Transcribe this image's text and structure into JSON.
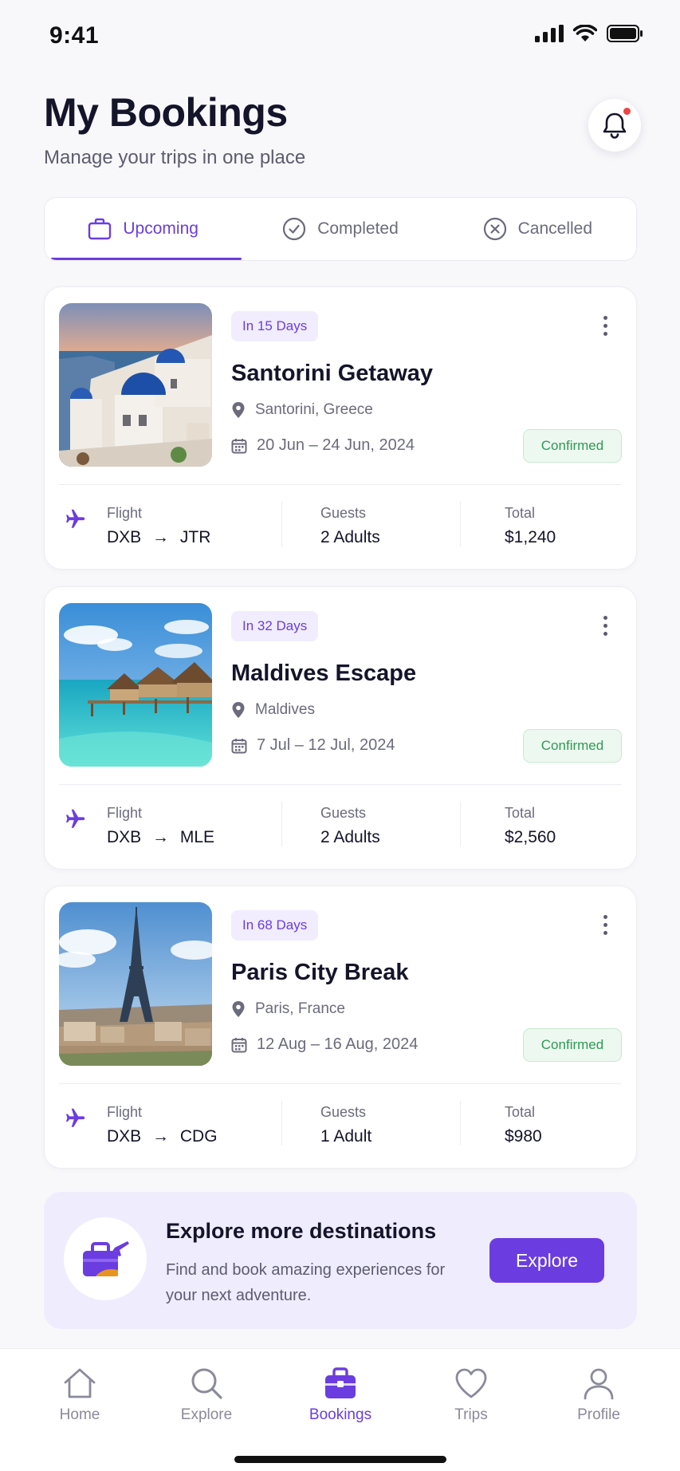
{
  "status_bar": {
    "time": "9:41"
  },
  "header": {
    "title": "My Bookings",
    "subtitle": "Manage your trips in one place",
    "notification_icon": "bell-icon"
  },
  "tabs": [
    {
      "label": "Upcoming",
      "icon": "briefcase-icon",
      "active": true
    },
    {
      "label": "Completed",
      "icon": "check-circle-icon",
      "active": false
    },
    {
      "label": "Cancelled",
      "icon": "x-circle-icon",
      "active": false
    }
  ],
  "bookings": [
    {
      "badge": "In 15 Days",
      "title": "Santorini Getaway",
      "location": "Santorini, Greece",
      "dates": "20 Jun – 24 Jun, 2024",
      "status": "Confirmed",
      "flight_label": "Flight",
      "flight_from": "DXB",
      "flight_to": "JTR",
      "guests_label": "Guests",
      "guests": "2 Adults",
      "total_label": "Total",
      "total": "$1,240"
    },
    {
      "badge": "In 32 Days",
      "title": "Maldives Escape",
      "location": "Maldives",
      "dates": "7 Jul – 12 Jul, 2024",
      "status": "Confirmed",
      "flight_label": "Flight",
      "flight_from": "DXB",
      "flight_to": "MLE",
      "guests_label": "Guests",
      "guests": "2 Adults",
      "total_label": "Total",
      "total": "$2,560"
    },
    {
      "badge": "In 68 Days",
      "title": "Paris City Break",
      "location": "Paris, France",
      "dates": "12 Aug – 16 Aug, 2024",
      "status": "Confirmed",
      "flight_label": "Flight",
      "flight_from": "DXB",
      "flight_to": "CDG",
      "guests_label": "Guests",
      "guests": "1 Adult",
      "total_label": "Total",
      "total": "$980"
    }
  ],
  "promo": {
    "title": "Explore more destinations",
    "text": "Find and book amazing experiences for your next adventure.",
    "button": "Explore"
  },
  "bottom_nav": [
    {
      "label": "Home",
      "icon": "home-icon",
      "active": false
    },
    {
      "label": "Explore",
      "icon": "search-icon",
      "active": false
    },
    {
      "label": "Bookings",
      "icon": "briefcase-icon",
      "active": true
    },
    {
      "label": "Trips",
      "icon": "heart-icon",
      "active": false
    },
    {
      "label": "Profile",
      "icon": "user-icon",
      "active": false
    }
  ],
  "colors": {
    "accent": "#6b3de0",
    "confirmed": "#2f9a55",
    "notification_dot": "#ef4444"
  }
}
